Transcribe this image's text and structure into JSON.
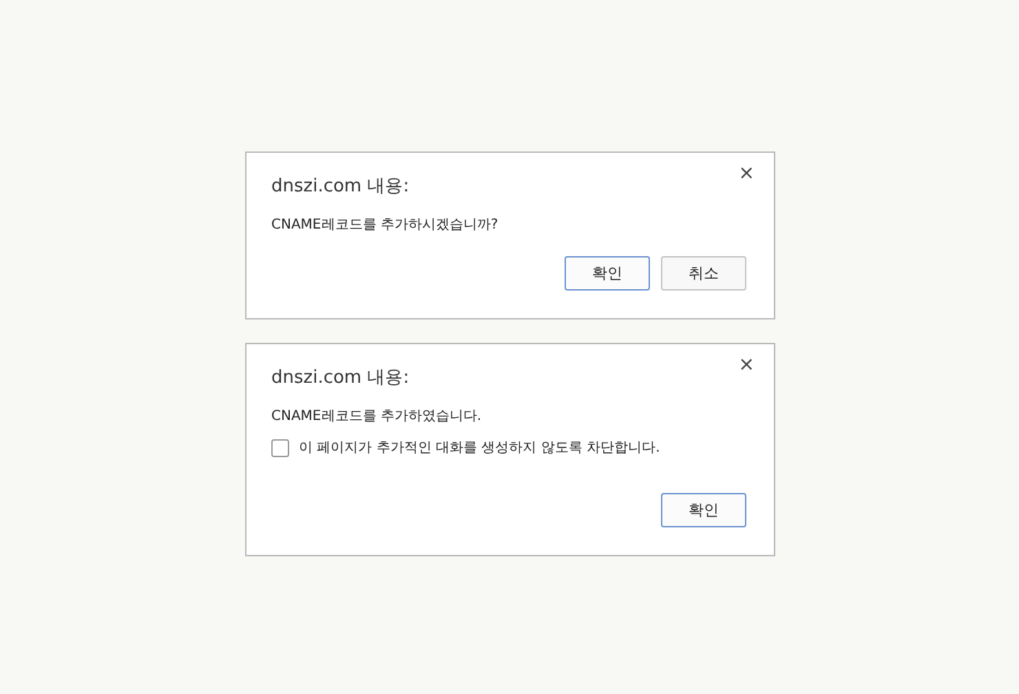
{
  "dialogs": [
    {
      "title": "dnszi.com 내용:",
      "close": "×",
      "message": "CNAME레코드를 추가하시겠습니까?",
      "buttons": [
        {
          "label": "확인",
          "focused": true
        },
        {
          "label": "취소",
          "focused": false
        }
      ]
    },
    {
      "title": "dnszi.com 내용:",
      "close": "×",
      "message": "CNAME레코드를 추가하였습니다.",
      "checkbox": {
        "label": "이 페이지가 추가적인 대화를 생성하지 않도록 차단합니다.",
        "checked": false
      },
      "buttons": [
        {
          "label": "확인",
          "focused": true
        }
      ]
    }
  ]
}
